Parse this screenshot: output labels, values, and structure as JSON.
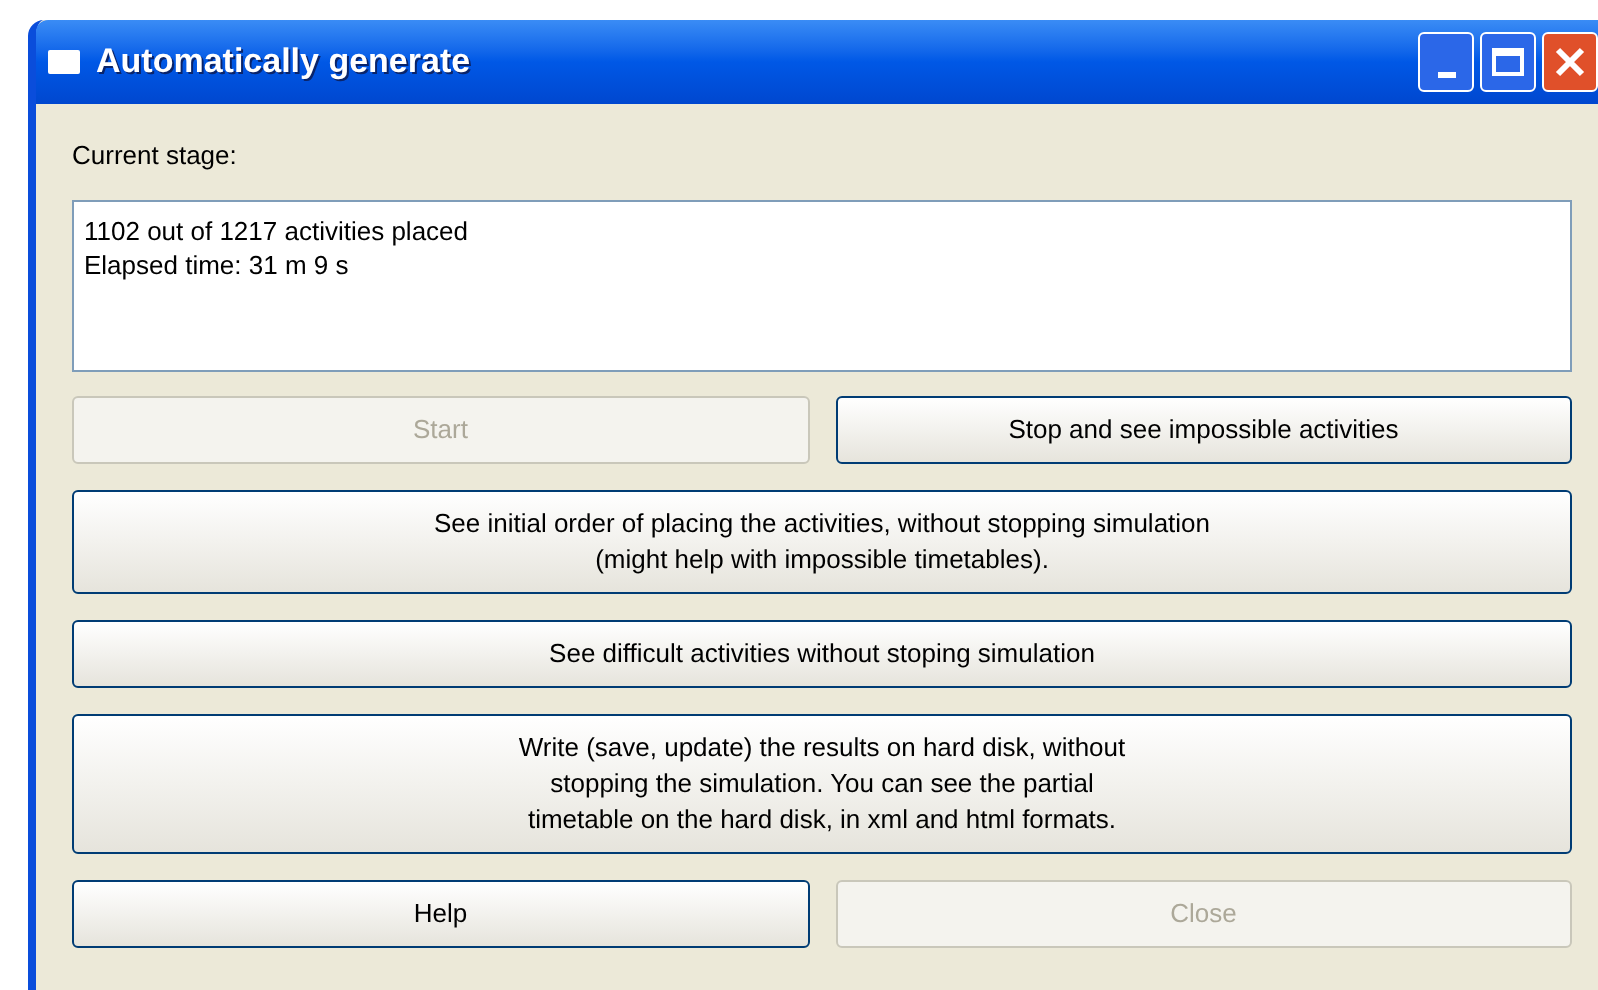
{
  "window": {
    "title": "Automatically generate"
  },
  "stage_label": "Current stage:",
  "stage_text": [
    "1102 out of 1217 activities placed",
    "Elapsed time: 31 m 9 s"
  ],
  "button_rows": [
    [
      {
        "lines": [
          "Start"
        ],
        "disabled": true
      },
      {
        "lines": [
          "Stop and see impossible activities"
        ],
        "disabled": false
      }
    ],
    [
      {
        "lines": [
          "See initial order of placing the activities, without stopping simulation",
          "(might help with impossible timetables)."
        ],
        "disabled": false
      }
    ],
    [
      {
        "lines": [
          "See difficult activities without stoping simulation"
        ],
        "disabled": false
      }
    ],
    [
      {
        "lines": [
          "Write (save, update) the results on hard disk, without",
          "stopping the simulation. You can see the partial",
          "timetable on the hard disk, in xml and html formats."
        ],
        "disabled": false
      }
    ],
    [
      {
        "lines": [
          "Help"
        ],
        "disabled": false
      },
      {
        "lines": [
          "Close"
        ],
        "disabled": true
      }
    ]
  ]
}
